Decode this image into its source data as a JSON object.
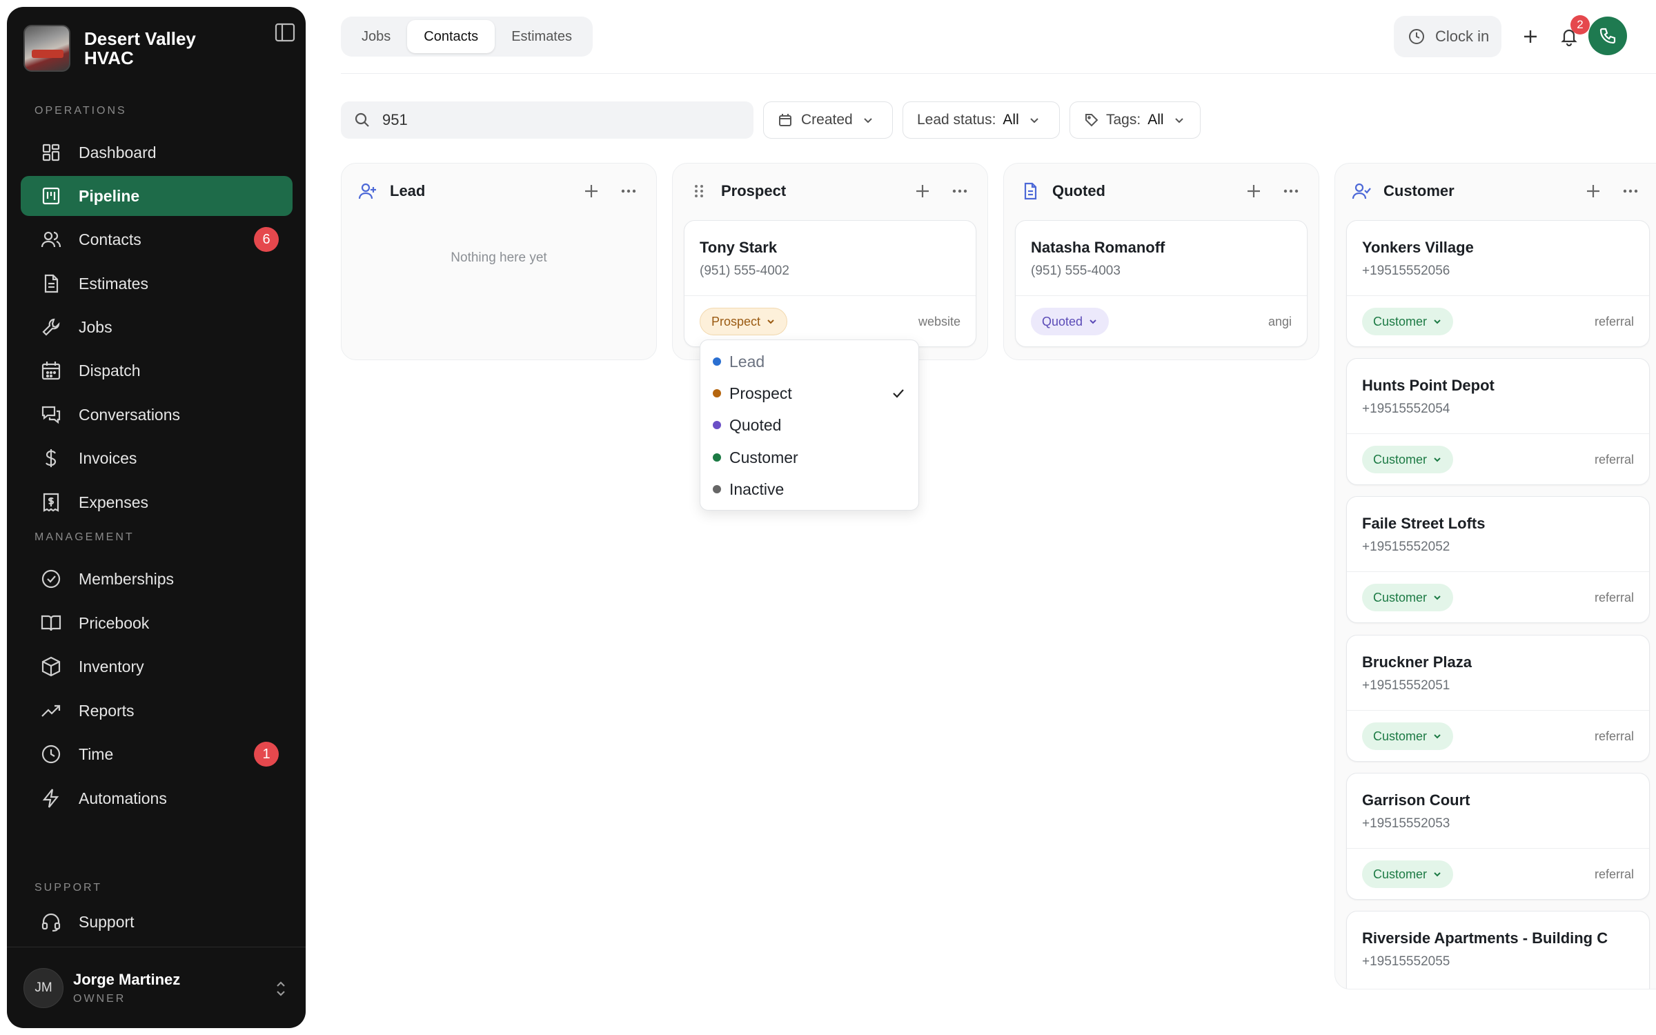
{
  "brand": {
    "name": "Desert Valley HVAC"
  },
  "sidebar": {
    "sections": {
      "operations": "OPERATIONS",
      "management": "MANAGEMENT",
      "support": "SUPPORT"
    },
    "items": [
      {
        "label": "Dashboard",
        "icon": "dashboard-icon"
      },
      {
        "label": "Pipeline",
        "icon": "pipeline-icon",
        "active": true
      },
      {
        "label": "Contacts",
        "icon": "contacts-icon",
        "badge": "6"
      },
      {
        "label": "Estimates",
        "icon": "document-icon"
      },
      {
        "label": "Jobs",
        "icon": "wrench-icon"
      },
      {
        "label": "Dispatch",
        "icon": "calendar-icon"
      },
      {
        "label": "Conversations",
        "icon": "chat-icon"
      },
      {
        "label": "Invoices",
        "icon": "dollar-icon"
      },
      {
        "label": "Expenses",
        "icon": "receipt-icon"
      },
      {
        "label": "Memberships",
        "icon": "badge-check-icon"
      },
      {
        "label": "Pricebook",
        "icon": "book-icon"
      },
      {
        "label": "Inventory",
        "icon": "box-icon"
      },
      {
        "label": "Reports",
        "icon": "trend-icon"
      },
      {
        "label": "Time",
        "icon": "clock-icon",
        "badge": "1"
      },
      {
        "label": "Automations",
        "icon": "bolt-icon"
      },
      {
        "label": "Support",
        "icon": "headset-icon"
      }
    ],
    "user": {
      "initials": "JM",
      "name": "Jorge Martinez",
      "role": "OWNER"
    }
  },
  "header": {
    "tabs": [
      {
        "label": "Jobs"
      },
      {
        "label": "Contacts",
        "active": true
      },
      {
        "label": "Estimates"
      }
    ],
    "clock_in": "Clock in",
    "notification_count": "2"
  },
  "filters": {
    "search_value": "951",
    "created": "Created",
    "lead_status_label": "Lead status:",
    "lead_status_value": "All",
    "tags_label": "Tags:",
    "tags_value": "All"
  },
  "columns": [
    {
      "title": "Lead",
      "empty": "Nothing here yet",
      "cards": []
    },
    {
      "title": "Prospect",
      "cards": [
        {
          "name": "Tony Stark",
          "phone": "(951) 555-4002",
          "status": "Prospect",
          "source": "website"
        }
      ]
    },
    {
      "title": "Quoted",
      "cards": [
        {
          "name": "Natasha Romanoff",
          "phone": "(951) 555-4003",
          "status": "Quoted",
          "source": "angi"
        }
      ]
    },
    {
      "title": "Customer",
      "cards": [
        {
          "name": "Yonkers Village",
          "phone": "+19515552056",
          "status": "Customer",
          "source": "referral"
        },
        {
          "name": "Hunts Point Depot",
          "phone": "+19515552054",
          "status": "Customer",
          "source": "referral"
        },
        {
          "name": "Faile Street Lofts",
          "phone": "+19515552052",
          "status": "Customer",
          "source": "referral"
        },
        {
          "name": "Bruckner Plaza",
          "phone": "+19515552051",
          "status": "Customer",
          "source": "referral"
        },
        {
          "name": "Garrison Court",
          "phone": "+19515552053",
          "status": "Customer",
          "source": "referral"
        },
        {
          "name": "Riverside Apartments - Building C",
          "phone": "+19515552055"
        }
      ]
    }
  ],
  "status_menu": {
    "options": [
      {
        "label": "Lead",
        "color": "#2a6fd1"
      },
      {
        "label": "Prospect",
        "color": "#b5650e",
        "selected": true
      },
      {
        "label": "Quoted",
        "color": "#6a4fc6"
      },
      {
        "label": "Customer",
        "color": "#1c7a44"
      },
      {
        "label": "Inactive",
        "color": "#666666"
      }
    ]
  },
  "colors": {
    "accent": "#1e6b49",
    "badge": "#e5484d"
  }
}
